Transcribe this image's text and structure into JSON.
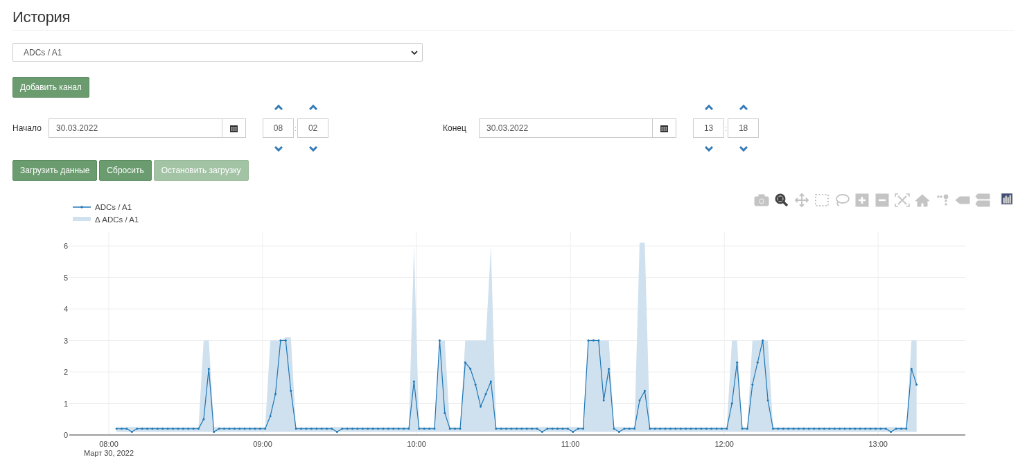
{
  "title": "История",
  "channel_select": {
    "value": "ADCs / A1"
  },
  "add_button": {
    "label": "Добавить канал"
  },
  "ranges": [
    {
      "label": "Начало",
      "date": "30.03.2022",
      "hour": "08",
      "separator": ":",
      "minute": "02"
    },
    {
      "label": "Конец",
      "date": "30.03.2022",
      "hour": "13",
      "separator": ":",
      "minute": "18"
    }
  ],
  "actions": [
    {
      "label": "Загрузить данные",
      "disabled": false
    },
    {
      "label": "Сбросить",
      "disabled": false
    },
    {
      "label": "Остановить загрузку",
      "disabled": true
    }
  ],
  "modebar": [
    {
      "kind": "camera",
      "selected": false
    },
    {
      "kind": "zoom",
      "selected": true
    },
    {
      "kind": "pan",
      "selected": false
    },
    {
      "kind": "box",
      "selected": false
    },
    {
      "kind": "lasso",
      "selected": false
    },
    {
      "kind": "zoom-in",
      "selected": false
    },
    {
      "kind": "zoom-out",
      "selected": false
    },
    {
      "kind": "autoscale",
      "selected": false
    },
    {
      "kind": "home",
      "selected": false
    },
    {
      "kind": "spikes",
      "selected": false
    },
    {
      "kind": "closest",
      "selected": false
    },
    {
      "kind": "compare",
      "selected": false
    },
    {
      "kind": "logo",
      "selected": false
    }
  ],
  "chart": {
    "date_label": "Март 30, 2022",
    "chart_data": {
      "type": "line",
      "grid": true,
      "legend": true,
      "xlim": [
        464.6,
        814
      ],
      "ylim": [
        0,
        6.45
      ],
      "xticks": [
        {
          "value": 480,
          "label": "08:00"
        },
        {
          "value": 540,
          "label": "09:00"
        },
        {
          "value": 600,
          "label": "10:00"
        },
        {
          "value": 660,
          "label": "11:00"
        },
        {
          "value": 720,
          "label": "12:00"
        },
        {
          "value": 780,
          "label": "13:00"
        }
      ],
      "yticks": [
        0,
        1,
        2,
        3,
        4,
        5,
        6
      ],
      "x": [
        483,
        485,
        487,
        489,
        491,
        493,
        495,
        497,
        499,
        501,
        503,
        505,
        507,
        509,
        511,
        513,
        515,
        517,
        519,
        521,
        523,
        525,
        527,
        529,
        531,
        533,
        535,
        537,
        539,
        541,
        543,
        545,
        547,
        549,
        551,
        553,
        555,
        557,
        559,
        561,
        563,
        565,
        567,
        569,
        571,
        573,
        575,
        577,
        579,
        581,
        583,
        585,
        587,
        589,
        591,
        593,
        595,
        597,
        599,
        601,
        603,
        605,
        607,
        609,
        611,
        613,
        615,
        617,
        619,
        621,
        623,
        625,
        627,
        629,
        631,
        633,
        635,
        637,
        639,
        641,
        643,
        645,
        647,
        649,
        651,
        653,
        655,
        657,
        659,
        661,
        663,
        665,
        667,
        669,
        671,
        673,
        675,
        677,
        679,
        681,
        683,
        685,
        687,
        689,
        691,
        693,
        695,
        697,
        699,
        701,
        703,
        705,
        707,
        709,
        711,
        713,
        715,
        717,
        719,
        721,
        723,
        725,
        727,
        729,
        731,
        733,
        735,
        737,
        739,
        741,
        743,
        745,
        747,
        749,
        751,
        753,
        755,
        757,
        759,
        761,
        763,
        765,
        767,
        769,
        771,
        773,
        775,
        777,
        779,
        781,
        783,
        785,
        787,
        789,
        791,
        793,
        795
      ],
      "series": [
        {
          "name": "ADCs / A1",
          "color": "#1f77b4",
          "values": [
            0.2,
            0.2,
            0.2,
            0.1,
            0.2,
            0.2,
            0.2,
            0.2,
            0.2,
            0.2,
            0.2,
            0.2,
            0.2,
            0.2,
            0.2,
            0.2,
            0.2,
            0.5,
            2.1,
            0.1,
            0.2,
            0.2,
            0.2,
            0.2,
            0.2,
            0.2,
            0.2,
            0.2,
            0.2,
            0.2,
            0.6,
            1.3,
            3,
            3,
            1.4,
            0.2,
            0.2,
            0.2,
            0.2,
            0.2,
            0.2,
            0.2,
            0.2,
            0.1,
            0.2,
            0.2,
            0.2,
            0.2,
            0.2,
            0.2,
            0.2,
            0.2,
            0.2,
            0.2,
            0.2,
            0.2,
            0.2,
            0.2,
            1.7,
            0.2,
            0.2,
            0.2,
            0.2,
            3,
            0.7,
            0.2,
            0.2,
            0.2,
            2.3,
            2.1,
            1.6,
            0.9,
            1.3,
            1.7,
            0.2,
            0.2,
            0.2,
            0.2,
            0.2,
            0.2,
            0.2,
            0.2,
            0.2,
            0.1,
            0.2,
            0.2,
            0.2,
            0.2,
            0.2,
            0.1,
            0.2,
            0.2,
            3,
            3,
            3,
            1.1,
            2.1,
            0.2,
            0.1,
            0.2,
            0.2,
            0.2,
            1.1,
            1.4,
            0.2,
            0.2,
            0.2,
            0.2,
            0.2,
            0.2,
            0.2,
            0.2,
            0.2,
            0.2,
            0.2,
            0.2,
            0.2,
            0.2,
            0.2,
            0.2,
            1,
            2.3,
            0.2,
            0.2,
            1.6,
            2.3,
            3,
            1.1,
            0.2,
            0.2,
            0.2,
            0.2,
            0.2,
            0.2,
            0.2,
            0.2,
            0.2,
            0.2,
            0.2,
            0.2,
            0.2,
            0.2,
            0.2,
            0.2,
            0.2,
            0.2,
            0.2,
            0.2,
            0.2,
            0.2,
            0.2,
            0.1,
            0.2,
            0.2,
            0.2,
            2.1,
            1.6
          ]
        },
        {
          "name": "Δ ADCs / A1",
          "type": "area",
          "color": "#cfe0ee",
          "values": [
            0.25,
            0.25,
            0.25,
            0.25,
            0.25,
            0.25,
            0.25,
            0.25,
            0.25,
            0.25,
            0.25,
            0.25,
            0.25,
            0.25,
            0.25,
            0.25,
            0.25,
            3,
            3,
            0.25,
            0.25,
            0.25,
            0.25,
            0.25,
            0.25,
            0.25,
            0.25,
            0.25,
            0.25,
            0.25,
            3,
            3,
            3,
            3.1,
            3.1,
            0.25,
            0.25,
            0.25,
            0.25,
            0.25,
            0.25,
            0.25,
            0.25,
            0.25,
            0.25,
            0.25,
            0.25,
            0.25,
            0.25,
            0.25,
            0.25,
            0.25,
            0.25,
            0.25,
            0.25,
            0.25,
            0.25,
            0.25,
            6,
            0.25,
            0.25,
            0.25,
            0.25,
            3,
            3,
            0.25,
            0.25,
            0.25,
            3,
            3,
            3,
            3,
            3,
            6,
            0.25,
            0.25,
            0.25,
            0.25,
            0.25,
            0.25,
            0.25,
            0.25,
            0.25,
            0.25,
            0.25,
            0.25,
            0.25,
            0.25,
            0.25,
            0.25,
            0.25,
            0.25,
            3,
            3.05,
            3,
            3,
            3,
            0.25,
            0.25,
            0.25,
            0.25,
            0.25,
            6.1,
            6.1,
            0.25,
            0.25,
            0.25,
            0.25,
            0.25,
            0.25,
            0.25,
            0.25,
            0.25,
            0.25,
            0.25,
            0.25,
            0.25,
            0.25,
            0.25,
            0.25,
            3,
            3,
            0.25,
            0.25,
            3,
            3,
            3,
            3,
            0.25,
            0.25,
            0.25,
            0.25,
            0.25,
            0.25,
            0.25,
            0.25,
            0.25,
            0.25,
            0.25,
            0.25,
            0.25,
            0.25,
            0.25,
            0.25,
            0.25,
            0.25,
            0.25,
            0.25,
            0.25,
            0.25,
            0.25,
            0.25,
            0.25,
            0.25,
            0.25,
            3,
            3
          ]
        }
      ]
    }
  }
}
